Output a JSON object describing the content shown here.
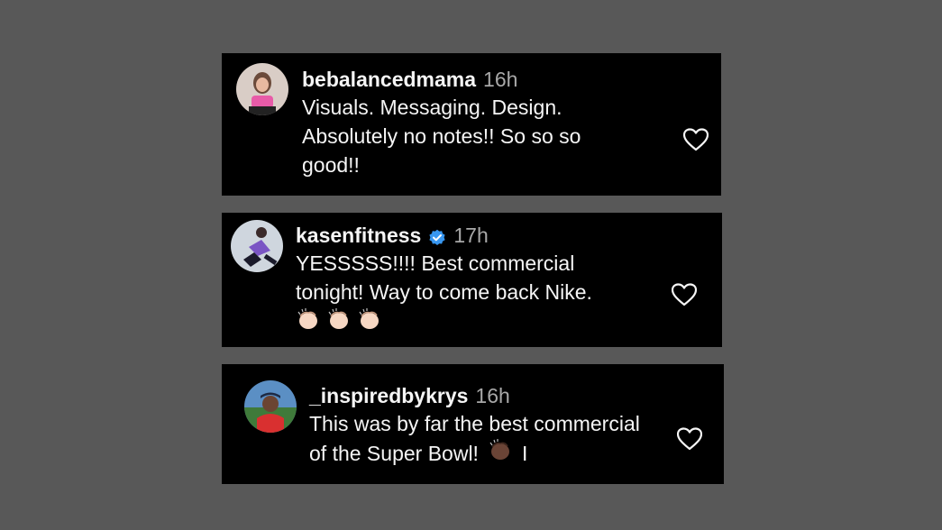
{
  "comments": [
    {
      "username": "bebalancedmama",
      "time": "16h",
      "lines": [
        "Visuals. Messaging. Design.",
        "Absolutely no notes!! So so so",
        "good!!"
      ],
      "verified": false
    },
    {
      "username": "kasenfitness",
      "time": "17h",
      "lines": [
        "YESSSSS!!!! Best commercial",
        "tonight! Way to come back Nike."
      ],
      "emojis": [
        "clapping-hands",
        "clapping-hands",
        "clapping-hands"
      ],
      "verified": true
    },
    {
      "username": "_inspiredbykrys",
      "time": "16h",
      "lines": [
        "This was by far the best commercial",
        "of the Super Bowl!"
      ],
      "trailing": "I",
      "emojis": [
        "clapping-hands-dark"
      ],
      "verified": false
    }
  ],
  "colors": {
    "page_background": "#585858",
    "card_background": "#000000",
    "text": "#f5f5f5",
    "time": "#a8a8a8",
    "verified": "#3897f0"
  }
}
